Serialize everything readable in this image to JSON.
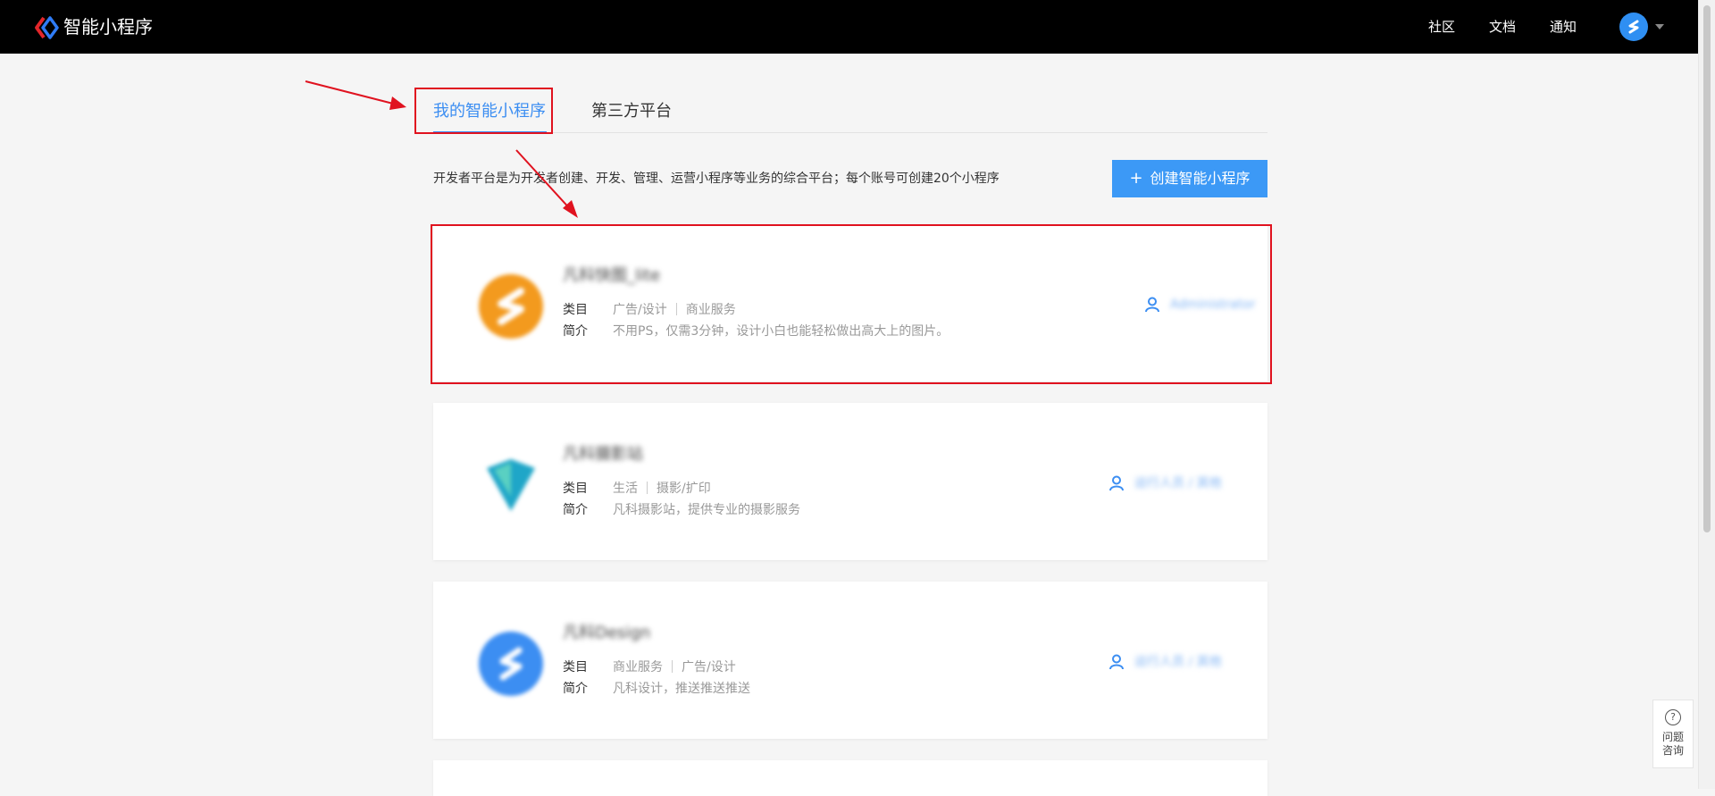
{
  "header": {
    "brand": "智能小程序",
    "nav": [
      "社区",
      "文档",
      "通知"
    ]
  },
  "tabs": [
    {
      "label": "我的智能小程序",
      "active": true
    },
    {
      "label": "第三方平台",
      "active": false
    }
  ],
  "description": "开发者平台是为开发者创建、开发、管理、运营小程序等业务的综合平台；每个账号可创建20个小程序",
  "create_button": {
    "label": "创建智能小程序"
  },
  "labels": {
    "category": "类目",
    "intro": "简介"
  },
  "apps": [
    {
      "name": "凡科快图_lite",
      "categories": [
        "广告/设计",
        "商业服务"
      ],
      "intro": "不用PS，仅需3分钟，设计小白也能轻松做出高大上的图片。",
      "member": "Administrator",
      "icon_color": "#f39a1e"
    },
    {
      "name": "凡科摄影站",
      "categories": [
        "生活",
        "摄影/扩印"
      ],
      "intro": "凡科摄影站，提供专业的摄影服务",
      "member": "运行人员 / 其他",
      "icon_color": "#1fa6c8"
    },
    {
      "name": "凡科Design",
      "categories": [
        "商业服务",
        "广告/设计"
      ],
      "intro": "凡科设计，推送推送推送",
      "member": "运行人员 / 其他",
      "icon_color": "#3c8ef2"
    }
  ],
  "help": {
    "line1": "问题",
    "line2": "咨询"
  },
  "colors": {
    "accent": "#3c8ef2",
    "button": "#3c99f6",
    "annotation": "#e0121f",
    "topbar": "#000000"
  }
}
